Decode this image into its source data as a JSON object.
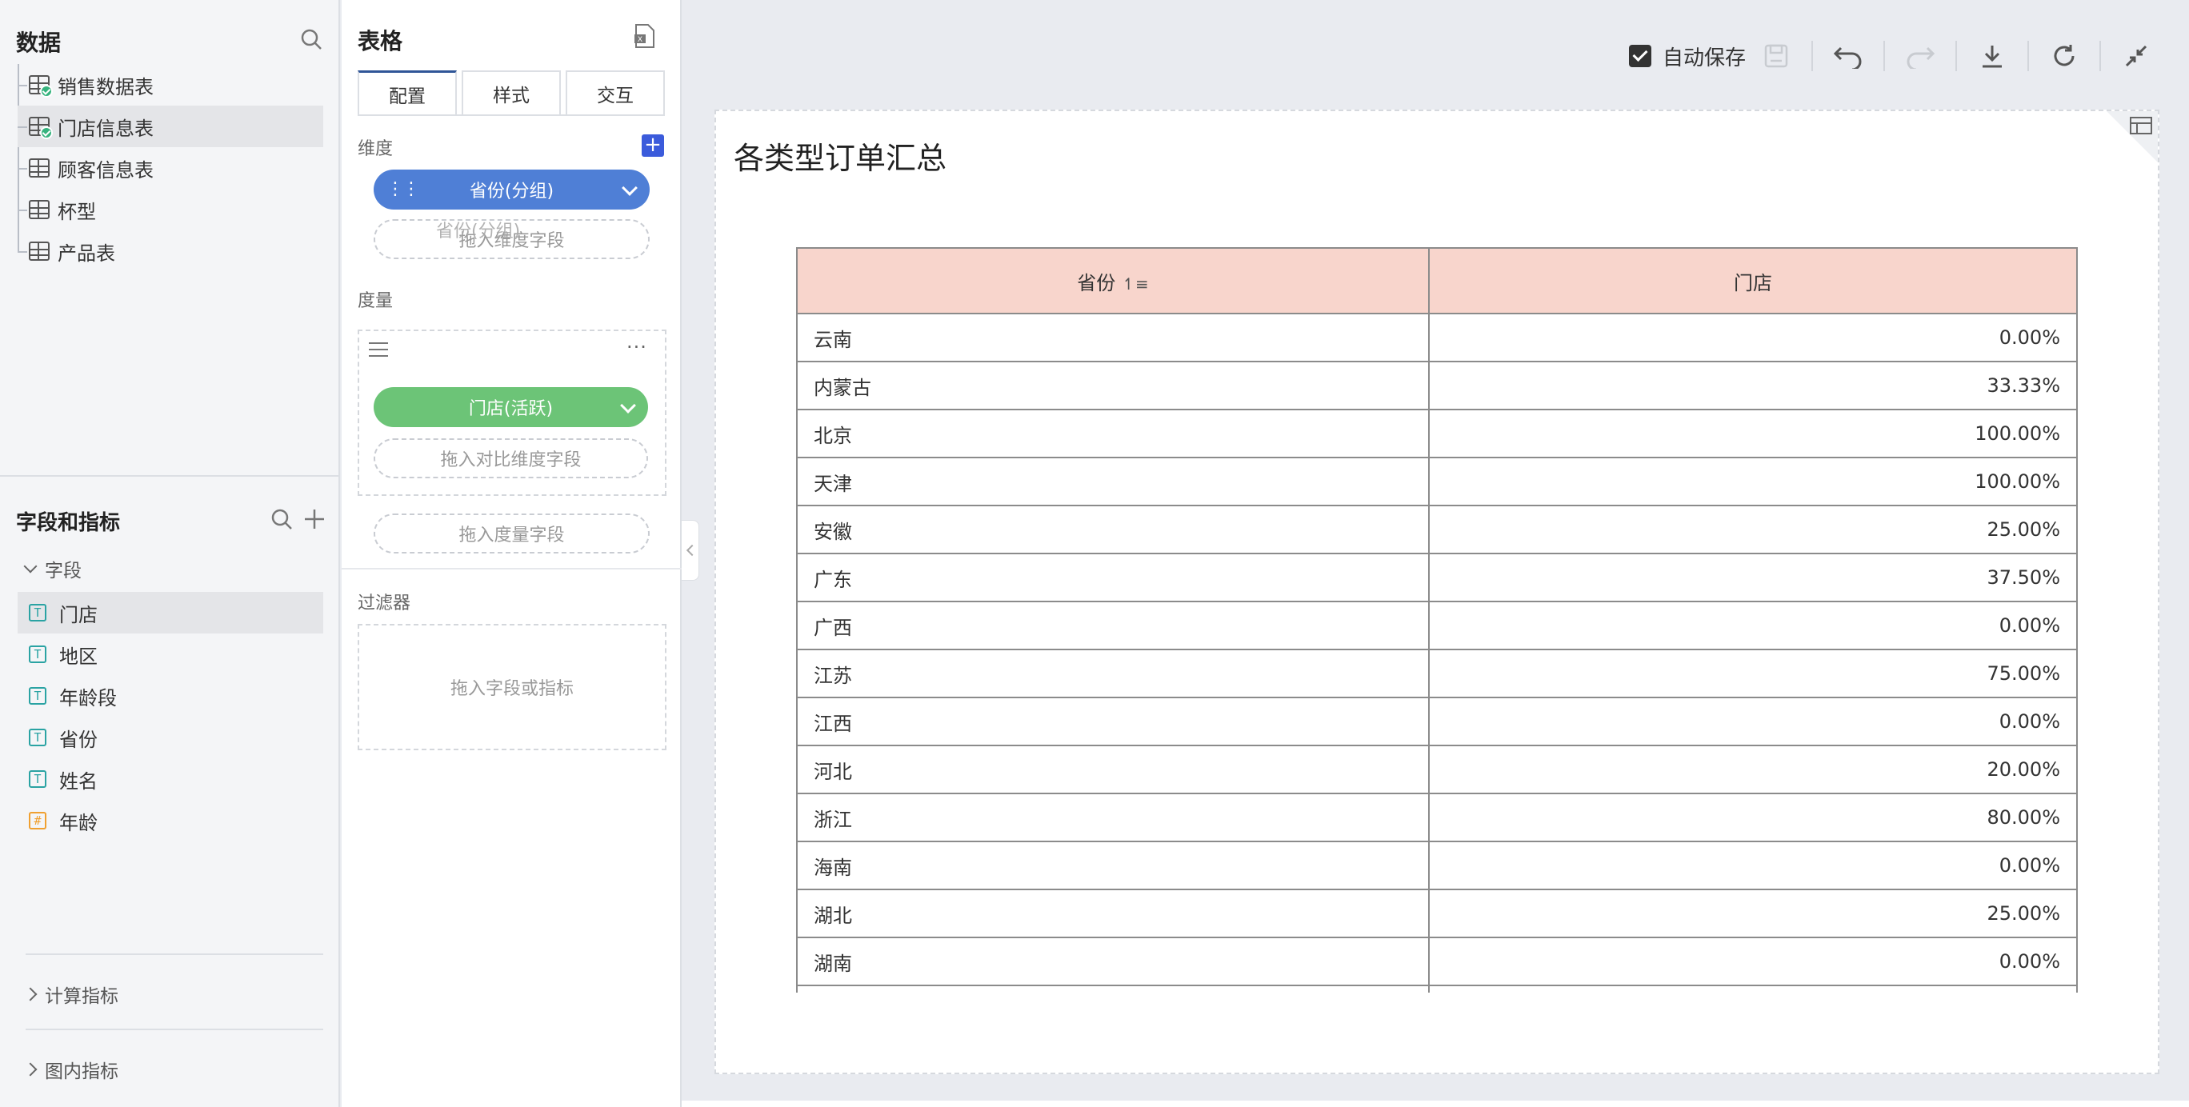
{
  "data_panel": {
    "title": "数据",
    "tables": [
      {
        "label": "销售数据表",
        "status": "ok"
      },
      {
        "label": "门店信息表",
        "status": "ok",
        "selected": true
      },
      {
        "label": "顾客信息表"
      },
      {
        "label": "杯型"
      },
      {
        "label": "产品表"
      }
    ]
  },
  "fields_panel": {
    "title": "字段和指标",
    "group_label": "字段",
    "fields": [
      {
        "label": "门店",
        "type": "T",
        "selected": true
      },
      {
        "label": "地区",
        "type": "T"
      },
      {
        "label": "年龄段",
        "type": "T"
      },
      {
        "label": "省份",
        "type": "T"
      },
      {
        "label": "姓名",
        "type": "T"
      },
      {
        "label": "年龄",
        "type": "#"
      }
    ],
    "calc_metrics": "计算指标",
    "chart_metrics": "图内指标"
  },
  "config_panel": {
    "title": "表格",
    "tabs": [
      "配置",
      "样式",
      "交互"
    ],
    "dimension_label": "维度",
    "dimension_pill": "省份(分组)",
    "dimension_drag_ghost": "省份(分组)",
    "dimension_drop": "拖入维度字段",
    "measure_label": "度量",
    "measure_pill": "门店(活跃)",
    "compare_drop": "拖入对比维度字段",
    "measure_drop": "拖入度量字段",
    "filter_label": "过滤器",
    "filter_drop": "拖入字段或指标",
    "colors": {
      "dimension": "#4f7fd6",
      "measure": "#6cc477"
    }
  },
  "toolbar": {
    "autosave_label": "自动保存",
    "autosave_checked": true
  },
  "card": {
    "title": "各类型订单汇总",
    "columns": [
      "省份",
      "门店"
    ],
    "rows": [
      [
        "云南",
        "0.00%"
      ],
      [
        "内蒙古",
        "33.33%"
      ],
      [
        "北京",
        "100.00%"
      ],
      [
        "天津",
        "100.00%"
      ],
      [
        "安徽",
        "25.00%"
      ],
      [
        "广东",
        "37.50%"
      ],
      [
        "广西",
        "0.00%"
      ],
      [
        "江苏",
        "75.00%"
      ],
      [
        "江西",
        "0.00%"
      ],
      [
        "河北",
        "20.00%"
      ],
      [
        "浙江",
        "80.00%"
      ],
      [
        "海南",
        "0.00%"
      ],
      [
        "湖北",
        "25.00%"
      ],
      [
        "湖南",
        "0.00%"
      ]
    ],
    "header_color": "#f8d5cc"
  }
}
